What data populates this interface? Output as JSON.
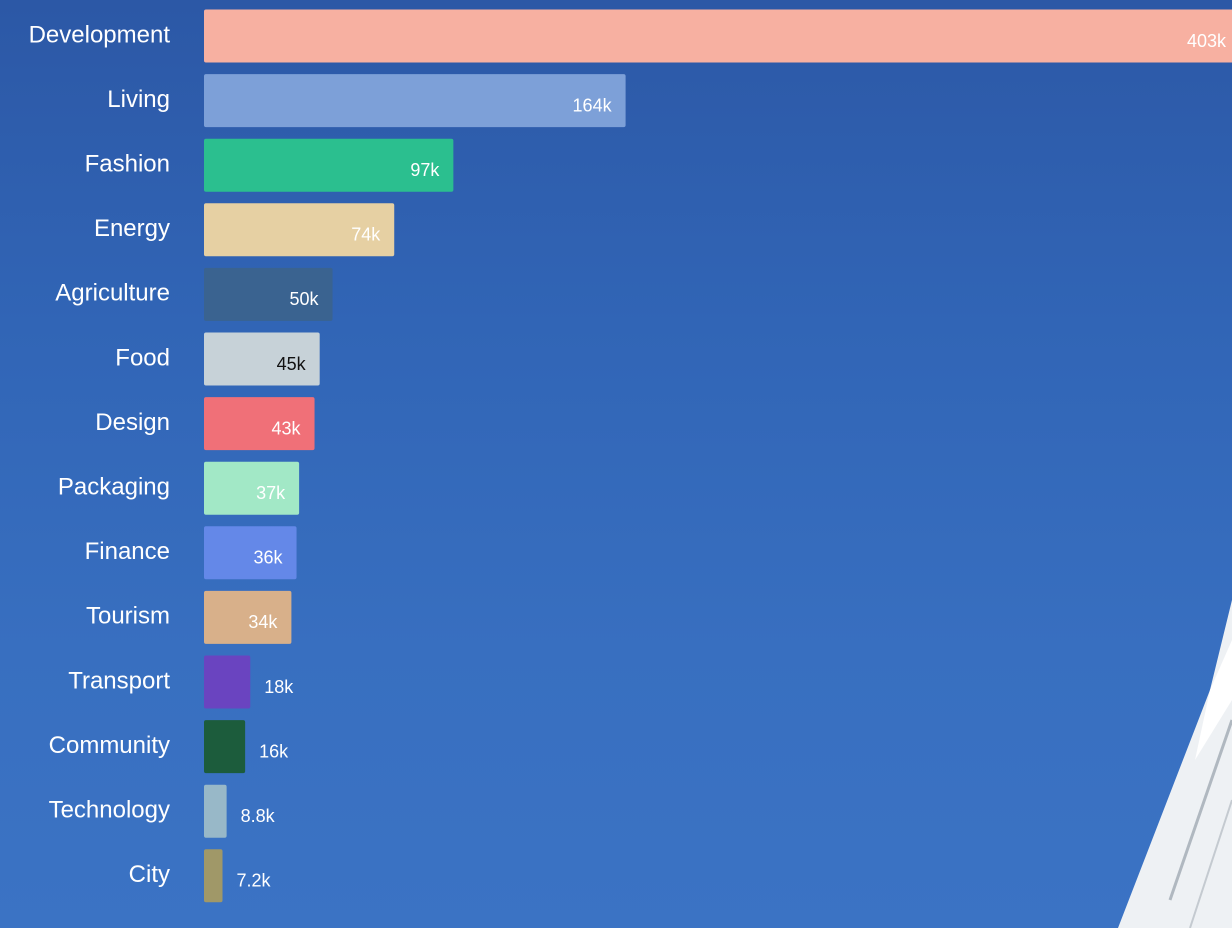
{
  "chart_data": {
    "type": "bar",
    "orientation": "horizontal",
    "categories": [
      "Development",
      "Living",
      "Fashion",
      "Energy",
      "Agriculture",
      "Food",
      "Design",
      "Packaging",
      "Finance",
      "Tourism",
      "Transport",
      "Community",
      "Technology",
      "City"
    ],
    "values": [
      403000,
      164000,
      97000,
      74000,
      50000,
      45000,
      43000,
      37000,
      36000,
      34000,
      18000,
      16000,
      8800,
      7200
    ],
    "value_labels": [
      "403k",
      "164k",
      "97k",
      "74k",
      "50k",
      "45k",
      "43k",
      "37k",
      "36k",
      "34k",
      "18k",
      "16k",
      "8.8k",
      "7.2k"
    ],
    "colors": [
      "#f7b0a1",
      "#7da0d8",
      "#2bbf8f",
      "#e6d0a3",
      "#3a6390",
      "#c7d2d8",
      "#f07078",
      "#a2e8c6",
      "#6488e8",
      "#d8b08a",
      "#6a44c0",
      "#1c5c3c",
      "#98b8c8",
      "#a09868"
    ],
    "value_label_colors": [
      "#ffffff",
      "#ffffff",
      "#ffffff",
      "#ffffff",
      "#ffffff",
      "#111111",
      "#ffffff",
      "#ffffff",
      "#ffffff",
      "#ffffff",
      "#ffffff",
      "#ffffff",
      "#ffffff",
      "#ffffff"
    ],
    "title": "",
    "xlabel": "",
    "ylabel": "",
    "xlim": [
      0,
      403000
    ],
    "grid": false,
    "legend": "none"
  }
}
